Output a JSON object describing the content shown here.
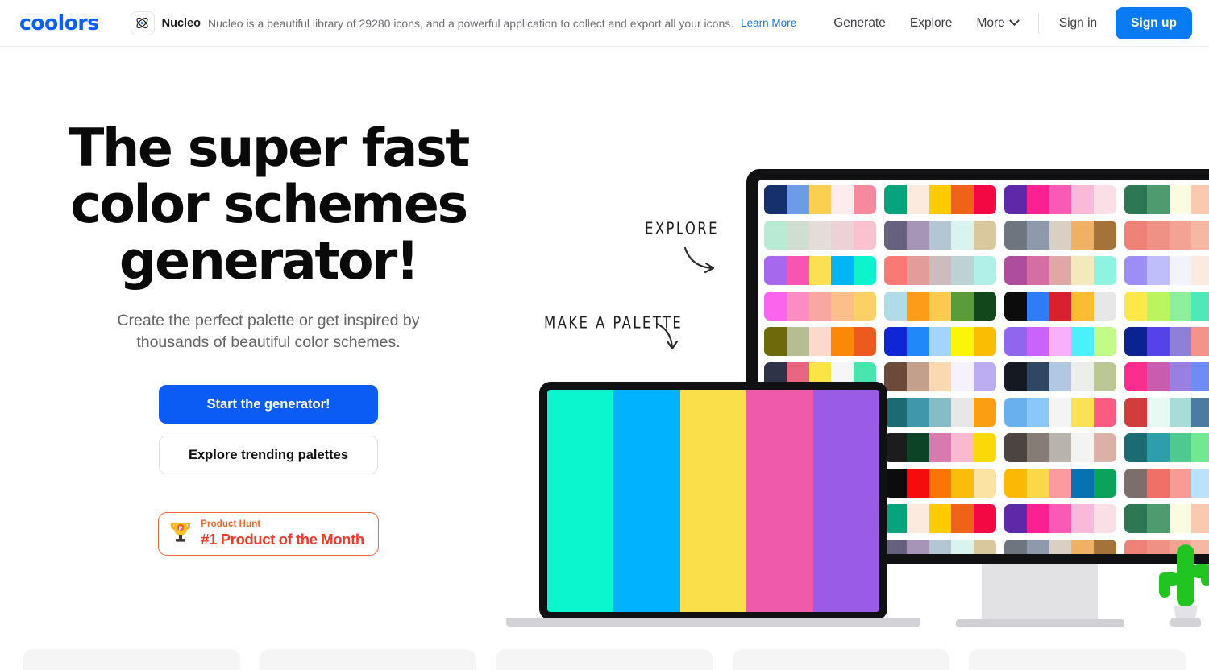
{
  "header": {
    "logo": "coolors",
    "promo": {
      "icon": "atom-icon",
      "brand": "Nucleo",
      "text": "Nucleo is a beautiful library of 29280 icons, and a powerful application to collect and export all your icons.",
      "link": "Learn More"
    },
    "nav": [
      {
        "label": "Generate",
        "name": "nav-generate"
      },
      {
        "label": "Explore",
        "name": "nav-explore"
      },
      {
        "label": "More",
        "name": "nav-more",
        "caret": true
      }
    ],
    "signin": "Sign in",
    "signup": "Sign up"
  },
  "hero": {
    "headline_line1": "The super fast",
    "headline_line2": "color schemes",
    "headline_line3": "generator!",
    "subhead_line1": "Create the perfect palette or get inspired by",
    "subhead_line2": "thousands of beautiful color schemes.",
    "cta_primary": "Start the generator!",
    "cta_secondary": "Explore trending palettes",
    "badge": {
      "icon": "trophy-icon",
      "top": "Product Hunt",
      "main": "#1 Product of the Month"
    },
    "annotations": [
      {
        "label": "EXPLORE",
        "name": "annotation-explore"
      },
      {
        "label": "MAKE A PALETTE",
        "name": "annotation-make-a-palette"
      }
    ]
  },
  "colors": {
    "brand_blue": "#0b61f5",
    "cta_blue": "#0b5cf5",
    "signup_blue": "#0b7bf5",
    "link_blue": "#1a73e8",
    "badge_orange": "#f2642a",
    "badge_red": "#f2392a",
    "device_black": "#111113",
    "cactus_green": "#22c422"
  },
  "laptop_palette": [
    "#0bf5ce",
    "#00b2ff",
    "#fbdf4a",
    "#ef5baa",
    "#9a5ce6"
  ],
  "monitor_palettes": [
    [
      "#16306b",
      "#6e9be8",
      "#fbcf51",
      "#fdeced",
      "#f7899f"
    ],
    [
      "#07a37d",
      "#fdeadf",
      "#ffcc00",
      "#ef6318",
      "#f40844"
    ],
    [
      "#5e29a8",
      "#fa2192",
      "#fb59b6",
      "#fbb9d9",
      "#fbdfe6"
    ],
    [
      "#2e7754",
      "#4d9b6f",
      "#fbfbe2",
      "#fbc8b0",
      "#e08937"
    ],
    [
      "#b8ead4",
      "#cfded0",
      "#e3dcd9",
      "#ecd2d6",
      "#f9c2ce"
    ],
    [
      "#66617f",
      "#a795b8",
      "#b4c5d4",
      "#d9f3ee",
      "#d9c89d"
    ],
    [
      "#6f757f",
      "#8e9aab",
      "#d9cfc3",
      "#efb163",
      "#a5733a"
    ],
    [
      "#ef8278",
      "#f09186",
      "#f2a394",
      "#f6b8a2",
      "#fbd1b5"
    ],
    [
      "#a668ec",
      "#f754b4",
      "#fbe052",
      "#03b5f5",
      "#0df3cd"
    ],
    [
      "#f97a75",
      "#e29d9b",
      "#ccbcbd",
      "#bcd2d4",
      "#b0f0e8"
    ],
    [
      "#ad4d9c",
      "#d56fa3",
      "#dfa8a7",
      "#f4e8bd",
      "#8ef3e0"
    ],
    [
      "#9c8df7",
      "#c0bdfb",
      "#f2f3fb",
      "#fbeadf",
      "#fbcfb0"
    ],
    [
      "#fb64ed",
      "#fb8cc4",
      "#f9a7a2",
      "#fcbe8b",
      "#fbd066"
    ],
    [
      "#b2dbe8",
      "#fb9d19",
      "#fbca4e",
      "#5b9c3a",
      "#11471a"
    ],
    [
      "#0c0c0c",
      "#2f7cf5",
      "#d8202f",
      "#fbbb33",
      "#e7e7e7"
    ],
    [
      "#fbe84a",
      "#bbf45e",
      "#8cf09c",
      "#4fe8b8",
      "#27d5f7"
    ],
    [
      "#6e6a0b",
      "#b6bd92",
      "#fbdacd",
      "#fb8807",
      "#ec5a1f"
    ],
    [
      "#1026d4",
      "#2088f9",
      "#a4d3fb",
      "#fbf509",
      "#fbbd04"
    ],
    [
      "#9066ef",
      "#c963fb",
      "#f9b0fb",
      "#4bf0fb",
      "#c2fb88"
    ],
    [
      "#0c2290",
      "#5542e8",
      "#8e7fd9",
      "#f3938a",
      "#f3549e"
    ],
    [
      "#2e3348",
      "#e8667f",
      "#fbe546",
      "#f6f6f6",
      "#48e5ae"
    ],
    [
      "#6b4a3b",
      "#c2a08b",
      "#fbd9b0",
      "#f5f2fb",
      "#bcadf0"
    ],
    [
      "#151a22",
      "#2f4763",
      "#b2c8e2",
      "#eceeec",
      "#bbc896"
    ],
    [
      "#fb2d8f",
      "#c95cae",
      "#9b7fe0",
      "#6f8bf5",
      "#48a3fb"
    ],
    [
      "#ee8093",
      "#ecb0cb",
      "#e8e0e3",
      "#b4d8e8",
      "#fbb04e"
    ],
    [
      "#1c6b73",
      "#4097ab",
      "#86bcc4",
      "#e7e7e7",
      "#fb9e12"
    ],
    [
      "#69b0ee",
      "#8ac8fb",
      "#f4f4f4",
      "#fbe252",
      "#fb5a83"
    ],
    [
      "#cf3d3d",
      "#e8f8f3",
      "#a8dcd9",
      "#4b7ba1",
      "#1a3450"
    ],
    [
      "#1c1c1c",
      "#0c4327",
      "#d97aae",
      "#fbb9cf",
      "#fbd808"
    ],
    [
      "#1c1c1c",
      "#0c4327",
      "#d97aae",
      "#fbb9cf",
      "#fbd808"
    ],
    [
      "#4b4440",
      "#857c76",
      "#b8b3ad",
      "#f3f3f2",
      "#dbb0a6"
    ],
    [
      "#1c6b73",
      "#2f9eab",
      "#4fc98f",
      "#73e892",
      "#c2f3c0"
    ],
    [
      "#0c0c0c",
      "#f50c0c",
      "#fb7505",
      "#fbbd0c",
      "#fbe3a4"
    ],
    [
      "#0c0c0c",
      "#f50c0c",
      "#fb7505",
      "#fbbd0c",
      "#fbe3a4"
    ],
    [
      "#fbb804",
      "#fbd84a",
      "#fb9ba0",
      "#0772ad",
      "#0ba35b"
    ],
    [
      "#7c6e6b",
      "#f07068",
      "#f79b95",
      "#bbe1fb",
      "#6b8efb"
    ],
    [
      "#07a37d",
      "#fdeadf",
      "#ffcc00",
      "#ef6318",
      "#f40844"
    ],
    [
      "#07a37d",
      "#fdeadf",
      "#ffcc00",
      "#ef6318",
      "#f40844"
    ],
    [
      "#5e29a8",
      "#fa2192",
      "#fb59b6",
      "#fbb9d9",
      "#fbdfe6"
    ],
    [
      "#2e7754",
      "#4d9b6f",
      "#fbfbe2",
      "#fbc8b0",
      "#e08937"
    ],
    [
      "#66617f",
      "#a795b8",
      "#b4c5d4",
      "#d9f3ee",
      "#d9c89d"
    ],
    [
      "#66617f",
      "#a795b8",
      "#b4c5d4",
      "#d9f3ee",
      "#d9c89d"
    ],
    [
      "#6f757f",
      "#8e9aab",
      "#d9cfc3",
      "#efb163",
      "#a5733a"
    ],
    [
      "#ef8278",
      "#f09186",
      "#f2a394",
      "#f6b8a2",
      "#fbd1b5"
    ]
  ],
  "bottom_cards": [
    {
      "name": "footer-card-1"
    },
    {
      "name": "footer-card-2"
    },
    {
      "name": "footer-card-3"
    },
    {
      "name": "footer-card-4"
    },
    {
      "name": "footer-card-5"
    }
  ]
}
